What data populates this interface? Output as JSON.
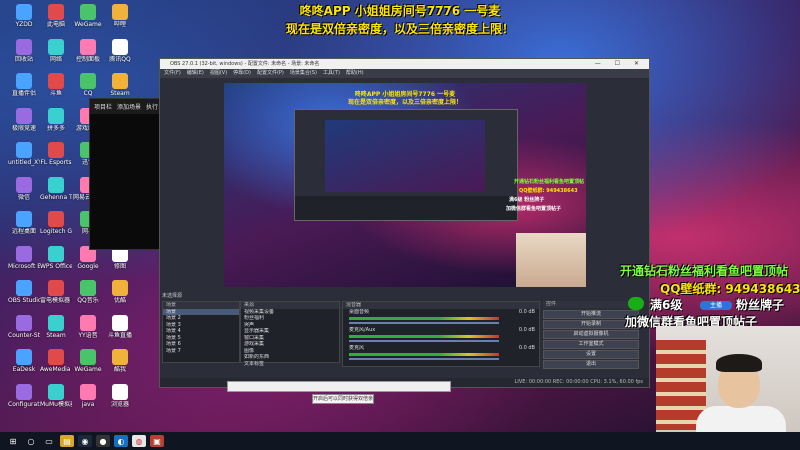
{
  "overlay": {
    "line1": "咚咚APP 小姐姐房间号7776 一号麦",
    "line2": "现在是双倍亲密度，以及三倍亲密度上限！"
  },
  "desktop": {
    "icons": [
      {
        "label": "YZDD"
      },
      {
        "label": "此电脑"
      },
      {
        "label": "WeGame"
      },
      {
        "label": "哔哩"
      },
      {
        "label": "回收站"
      },
      {
        "label": "网络"
      },
      {
        "label": "控制面板"
      },
      {
        "label": "腾讯QQ"
      },
      {
        "label": "直播伴侣"
      },
      {
        "label": "斗鱼"
      },
      {
        "label": "CQ"
      },
      {
        "label": "Steam"
      },
      {
        "label": "极限竞速"
      },
      {
        "label": "拼多多"
      },
      {
        "label": "游戏助手"
      },
      {
        "label": "酷狗"
      },
      {
        "label": "untitled_XY 14"
      },
      {
        "label": "FL Esports"
      },
      {
        "label": "迅雷"
      },
      {
        "label": "爱奇艺"
      },
      {
        "label": "微信"
      },
      {
        "label": "Gehenna Tag release"
      },
      {
        "label": "网易云音乐"
      },
      {
        "label": "百度"
      },
      {
        "label": "远程桌面"
      },
      {
        "label": "Logitech G HUB"
      },
      {
        "label": "网易"
      },
      {
        "label": "腾讯视频"
      },
      {
        "label": "Microsoft Edge"
      },
      {
        "label": "WPS Office"
      },
      {
        "label": "Google"
      },
      {
        "label": "修图"
      },
      {
        "label": "OBS Studio"
      },
      {
        "label": "雷电模拟器 Game"
      },
      {
        "label": "QQ音乐"
      },
      {
        "label": "优酷"
      },
      {
        "label": "Counter-Strike"
      },
      {
        "label": "Steam"
      },
      {
        "label": "YY语音"
      },
      {
        "label": "斗鱼直播"
      },
      {
        "label": "EaDesk"
      },
      {
        "label": "AweMedia RICentral"
      },
      {
        "label": "WeGame"
      },
      {
        "label": "酷我"
      },
      {
        "label": "Configuration"
      },
      {
        "label": "MuMu模拟器"
      },
      {
        "label": "java"
      },
      {
        "label": "浏览器"
      }
    ]
  },
  "black_panel": {
    "tabs": [
      "项目栏",
      "添加场景",
      "执行"
    ]
  },
  "obs": {
    "title": "OBS 27.0.1 (32-bit, windows) - 配置文件: 未命名 - 场景: 未命名",
    "window_controls": "—  ☐  ✕",
    "menu": [
      "文件(F)",
      "编辑(E)",
      "视图(V)",
      "停靠(D)",
      "配置文件(P)",
      "场景集合(S)",
      "工具(T)",
      "帮助(H)"
    ],
    "preview_overlay": {
      "line1": "咚咚APP 小姐姐房间号7776 一号麦",
      "line2": "现在是双倍亲密度，以及三倍亲密度上限！"
    },
    "docks": {
      "scenes_title": "场景",
      "sources_title": "来源",
      "mixer_title": "混音器",
      "controls_title": "控件"
    },
    "no_source_label": "未选择源",
    "scenes": [
      "场景",
      "场景 2",
      "场景 3",
      "场景 4",
      "场景 5",
      "场景 6",
      "场景 7"
    ],
    "sources": [
      "视频采集设备",
      "粉丝福利",
      "哭声",
      "显示器采集",
      "窗口采集",
      "游戏采集",
      "图像",
      "如新的东西",
      "文本标签"
    ],
    "mixer": [
      {
        "name": "桌面音频",
        "level": "0.0 dB"
      },
      {
        "name": "麦克风/Aux",
        "level": "0.0 dB"
      },
      {
        "name": "麦克风",
        "level": "0.0 dB"
      }
    ],
    "controls": [
      "开始推流",
      "开始录制",
      "启动虚拟摄像机",
      "工作室模式",
      "设置",
      "退出"
    ],
    "status": "LIVE: 00:00:00   REC: 00:00:00   CPU: 3.1%, 60.00 fps"
  },
  "tooltip": "开启后可以同时获得双倍亲密度",
  "ads": {
    "line1": "开通钻石粉丝福利看鱼吧置顶帖",
    "line2": "QQ壁纸群: 949438643",
    "line3_a": "满6级",
    "line3_badge": "主播",
    "line3_b": "粉丝牌子",
    "line4": "加微信群看鱼吧置顶帖子"
  },
  "preview_ads": {
    "line1": "开通钻石粉丝福利看鱼吧置顶帖",
    "line2": "QQ壁纸群: 949438643",
    "line3": "满6级 粉丝牌子",
    "line4": "加微信群看鱼吧置顶帖子"
  },
  "taskbar": {
    "items": [
      "windows-icon",
      "search-icon",
      "task-view-icon",
      "file-explorer-icon",
      "steam-icon",
      "obs-icon",
      "edge-icon",
      "chrome-icon",
      "app-icon"
    ]
  },
  "colors": {
    "overlay_yellow": "#ffe600",
    "ad_green": "#7dff3a",
    "obs_bg": "#2b2e38",
    "wechat_green": "#1aad19"
  }
}
